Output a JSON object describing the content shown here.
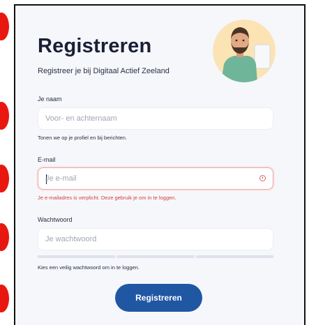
{
  "form": {
    "title": "Registreren",
    "subtitle": "Registreer je bij Digitaal Actief Zeeland",
    "name": {
      "label": "Je naam",
      "placeholder": "Voor- en achternaam",
      "hint": "Tonen we op je profiel en bij berichten."
    },
    "email": {
      "label": "E-mail",
      "placeholder": "Je e-mail",
      "error": "Je e-mailadres is verplicht. Deze gebruik je om in te loggen."
    },
    "password": {
      "label": "Wachtwoord",
      "placeholder": "Je wachtwoord",
      "hint": "Kies een veilig wachtwoord om in te loggen."
    },
    "submit_label": "Registreren"
  },
  "colors": {
    "primary_button": "#1f57a3",
    "error": "#d6403b",
    "marker": "#e8170f",
    "panel_bg": "#f5f7fb"
  },
  "icons": {
    "avatar": "man-with-laptop-illustration",
    "error_icon": "alert-circle-icon"
  }
}
